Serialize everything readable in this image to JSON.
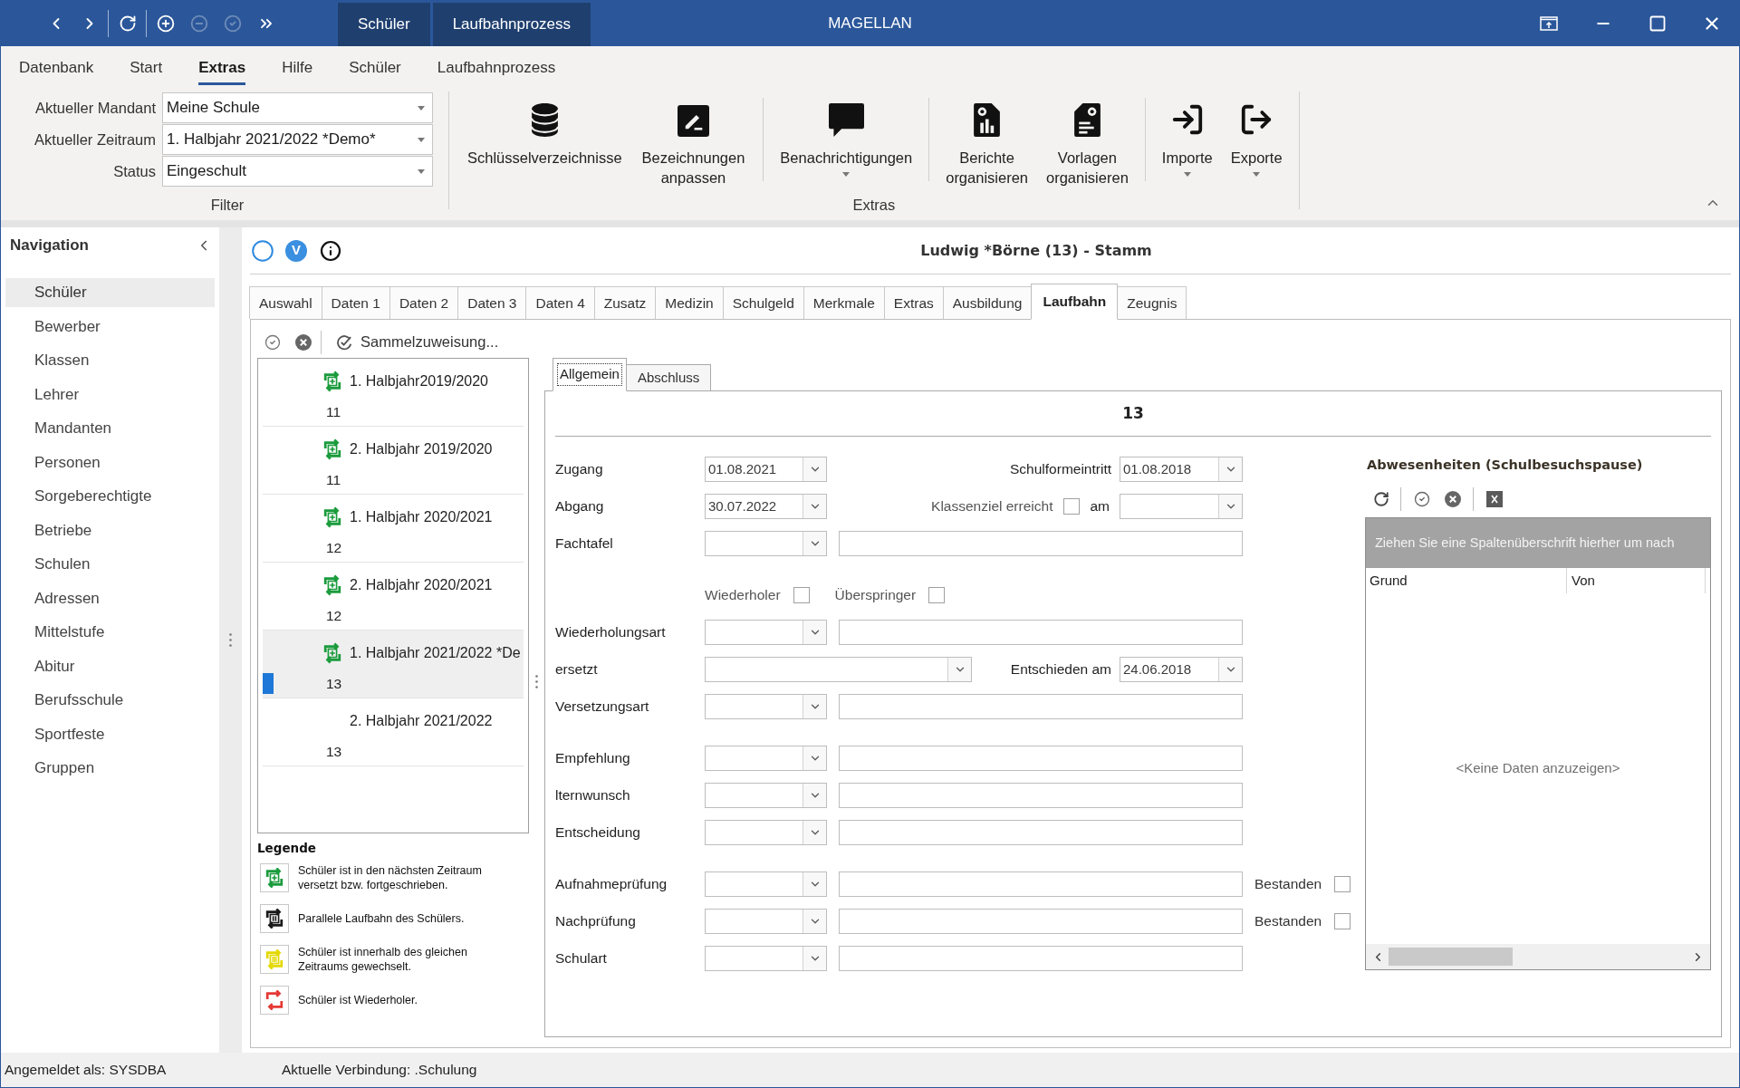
{
  "window": {
    "title": "MAGELLAN",
    "quick_access": [
      [
        {
          "disabled": false
        },
        {
          "disabled": false
        }
      ],
      [
        {
          "disabled": false
        }
      ],
      [
        {
          "disabled": false
        },
        {
          "disabled": true
        },
        {
          "disabled": true
        },
        {
          "disabled": false
        }
      ]
    ],
    "context_tabs": [
      "Schüler",
      "Laufbahnprozess"
    ]
  },
  "menu_tabs": [
    {
      "label": "Datenbank",
      "selected": false
    },
    {
      "label": "Start",
      "selected": false
    },
    {
      "label": "Extras",
      "selected": true
    },
    {
      "label": "Hilfe",
      "selected": false
    },
    {
      "label": "Schüler",
      "selected": false
    },
    {
      "label": "Laufbahnprozess",
      "selected": false
    }
  ],
  "ribbon": {
    "filter": {
      "label": "Filter",
      "fields": [
        {
          "label": "Aktueller Mandant",
          "value": "Meine Schule"
        },
        {
          "label": "Aktueller Zeitraum",
          "value": "1. Halbjahr 2021/2022 *Demo*"
        },
        {
          "label": "Status",
          "value": "Eingeschult"
        }
      ]
    },
    "extras": {
      "label": "Extras",
      "sections": [
        [
          {
            "label": "Schlüsselverzeichnisse",
            "dropdown": false
          },
          {
            "label": "Bezeichnungen anpassen",
            "dropdown": false
          }
        ],
        [
          {
            "label": "Benachrichtigungen",
            "dropdown": true
          }
        ],
        [
          {
            "label": "Berichte organisieren",
            "dropdown": false
          },
          {
            "label": "Vorlagen organisieren",
            "dropdown": false
          }
        ],
        [
          {
            "label": "Importe",
            "dropdown": true
          },
          {
            "label": "Exporte",
            "dropdown": true
          }
        ]
      ]
    }
  },
  "navigation": {
    "title": "Navigation",
    "items": [
      {
        "label": "Schüler",
        "selected": true
      },
      {
        "label": "Bewerber",
        "selected": false
      },
      {
        "label": "Klassen",
        "selected": false
      },
      {
        "label": "Lehrer",
        "selected": false
      },
      {
        "label": "Mandanten",
        "selected": false
      },
      {
        "label": "Personen",
        "selected": false
      },
      {
        "label": "Sorgeberechtigte",
        "selected": false
      },
      {
        "label": "Betriebe",
        "selected": false
      },
      {
        "label": "Schulen",
        "selected": false
      },
      {
        "label": "Adressen",
        "selected": false
      },
      {
        "label": "Mittelstufe",
        "selected": false
      },
      {
        "label": "Abitur",
        "selected": false
      },
      {
        "label": "Berufsschule",
        "selected": false
      },
      {
        "label": "Sportfeste",
        "selected": false
      },
      {
        "label": "Gruppen",
        "selected": false
      }
    ]
  },
  "record": {
    "badge": "V",
    "title": "Ludwig *Börne (13) - Stamm"
  },
  "tabs": [
    {
      "label": "Auswahl",
      "selected": false
    },
    {
      "label": "Daten 1",
      "selected": false
    },
    {
      "label": "Daten 2",
      "selected": false
    },
    {
      "label": "Daten 3",
      "selected": false
    },
    {
      "label": "Daten 4",
      "selected": false
    },
    {
      "label": "Zusatz",
      "selected": false
    },
    {
      "label": "Medizin",
      "selected": false
    },
    {
      "label": "Schulgeld",
      "selected": false
    },
    {
      "label": "Merkmale",
      "selected": false
    },
    {
      "label": "Extras",
      "selected": false
    },
    {
      "label": "Ausbildung",
      "selected": false
    },
    {
      "label": "Laufbahn",
      "selected": true
    },
    {
      "label": "Zeugnis",
      "selected": false
    }
  ],
  "periods_panel": {
    "toolbar_action": "Sammelzuweisung...",
    "items": [
      {
        "label": "1. Halbjahr2019/2020",
        "grade": "11",
        "kind": "promoted",
        "color": "#1a9b3c",
        "selected": false
      },
      {
        "label": "2. Halbjahr 2019/2020",
        "grade": "11",
        "kind": "promoted",
        "color": "#1a9b3c",
        "selected": false
      },
      {
        "label": "1. Halbjahr 2020/2021",
        "grade": "12",
        "kind": "promoted",
        "color": "#1a9b3c",
        "selected": false
      },
      {
        "label": "2. Halbjahr 2020/2021",
        "grade": "12",
        "kind": "promoted",
        "color": "#1a9b3c",
        "selected": false
      },
      {
        "label": "1. Halbjahr 2021/2022 *De",
        "grade": "13",
        "kind": "promoted",
        "color": "#1a9b3c",
        "selected": true
      },
      {
        "label": "2. Halbjahr 2021/2022",
        "grade": "13",
        "kind": "none",
        "selected": false
      }
    ],
    "legend": {
      "title": "Legende",
      "items": [
        {
          "kind": "promoted",
          "color": "#1a9b3c",
          "text": "Schüler ist in den nächsten Zeitraum versetzt bzw. fortgeschrieben."
        },
        {
          "kind": "parallel",
          "color": "#1a1a1a",
          "text": "Parallele Laufbahn des Schülers."
        },
        {
          "kind": "switched",
          "color": "#e3d800",
          "text": "Schüler ist innerhalb des gleichen Zeitraums gewechselt."
        },
        {
          "kind": "repeater",
          "color": "#e53935",
          "text": "Schüler ist Wiederholer."
        }
      ]
    }
  },
  "detail_tabs": [
    {
      "label": "Allgemein",
      "selected": true
    },
    {
      "label": "Abschluss",
      "selected": false
    }
  ],
  "form": {
    "heading": "13",
    "groups": [
      [
        {
          "kind": "date",
          "label": "Zugang",
          "value": "01.08.2021",
          "right": {
            "kind": "date",
            "label": "Schulformeintritt",
            "value": "01.08.2018"
          }
        },
        {
          "kind": "date",
          "label": "Abgang",
          "value": "30.07.2022",
          "right": {
            "kind": "check_date",
            "label": "Klassenziel erreicht",
            "checked": false,
            "suffix": "am"
          }
        },
        {
          "kind": "combo_text",
          "label": "Fachtafel"
        }
      ],
      [
        {
          "kind": "checks",
          "checks": [
            {
              "label": "Wiederholer",
              "checked": false
            },
            {
              "label": "Überspringer",
              "checked": false
            }
          ]
        },
        {
          "kind": "combo_text",
          "label": "Wiederholungsart"
        },
        {
          "kind": "wide",
          "label": "ersetzt",
          "right": {
            "kind": "date",
            "label": "Entschieden am",
            "value": "24.06.2018"
          }
        },
        {
          "kind": "combo_text",
          "label": "Versetzungsart"
        }
      ],
      [
        {
          "kind": "combo_text",
          "label": "Empfehlung"
        },
        {
          "kind": "combo_text",
          "label": "lternwunsch"
        },
        {
          "kind": "combo_text",
          "label": "Entscheidung"
        }
      ],
      [
        {
          "kind": "combo_text",
          "label": "Aufnahmeprüfung",
          "check": {
            "label": "Bestanden",
            "checked": false
          }
        },
        {
          "kind": "combo_text",
          "label": "Nachprüfung",
          "check": {
            "label": "Bestanden",
            "checked": false
          }
        },
        {
          "kind": "combo_text",
          "label": "Schulart"
        }
      ]
    ]
  },
  "absences": {
    "title": "Abwesenheiten (Schulbesuchspause)",
    "group_hint": "Ziehen Sie eine Spaltenüberschrift hierher um nach",
    "columns": [
      "Grund",
      "Von"
    ],
    "empty_text": "<Keine Daten anzuzeigen>"
  },
  "status_bar": {
    "user": "Angemeldet als: SYSDBA",
    "connection": "Aktuelle Verbindung: .Schulung"
  }
}
